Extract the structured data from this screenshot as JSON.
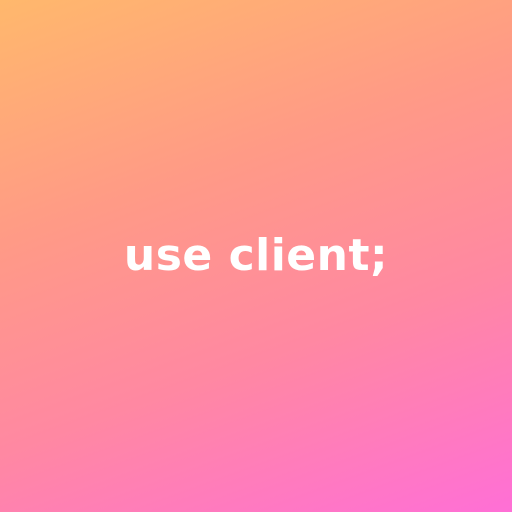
{
  "background": {
    "gradient_colors": [
      "#ffb86c",
      "#ff9a86",
      "#ff88a2",
      "#ff6fd6"
    ]
  },
  "headline": {
    "text": "use client;",
    "color": "#ffffff"
  }
}
